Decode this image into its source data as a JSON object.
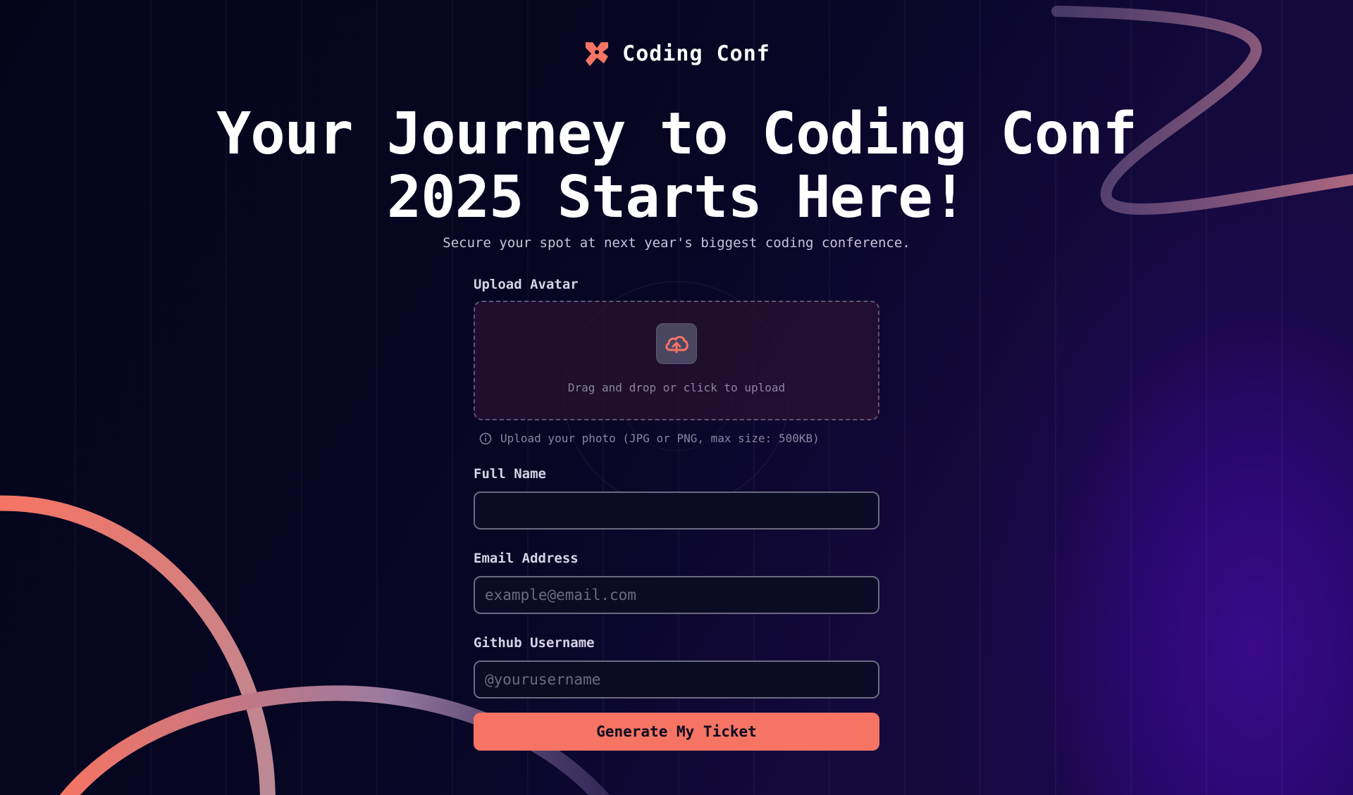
{
  "brand": {
    "name": "Coding Conf",
    "accent": "#f57463"
  },
  "hero": {
    "headline_line1": "Your Journey to Coding Conf",
    "headline_line2": "2025 Starts Here!",
    "subhead": "Secure your spot at next year's biggest coding conference."
  },
  "form": {
    "avatar": {
      "label": "Upload Avatar",
      "dropzone_text": "Drag and drop or click to upload",
      "icon": "upload-cloud-icon",
      "hint": "Upload your photo (JPG or PNG, max size: 500KB)"
    },
    "full_name": {
      "label": "Full Name",
      "value": "",
      "placeholder": ""
    },
    "email": {
      "label": "Email Address",
      "value": "",
      "placeholder": "example@email.com"
    },
    "github": {
      "label": "Github Username",
      "value": "",
      "placeholder": "@yourusername"
    },
    "submit_label": "Generate My Ticket"
  },
  "colors": {
    "background": "#06061c",
    "purple_glow": "#3a0a8a",
    "input_border": "#6d6a82",
    "button": "#f57463"
  }
}
